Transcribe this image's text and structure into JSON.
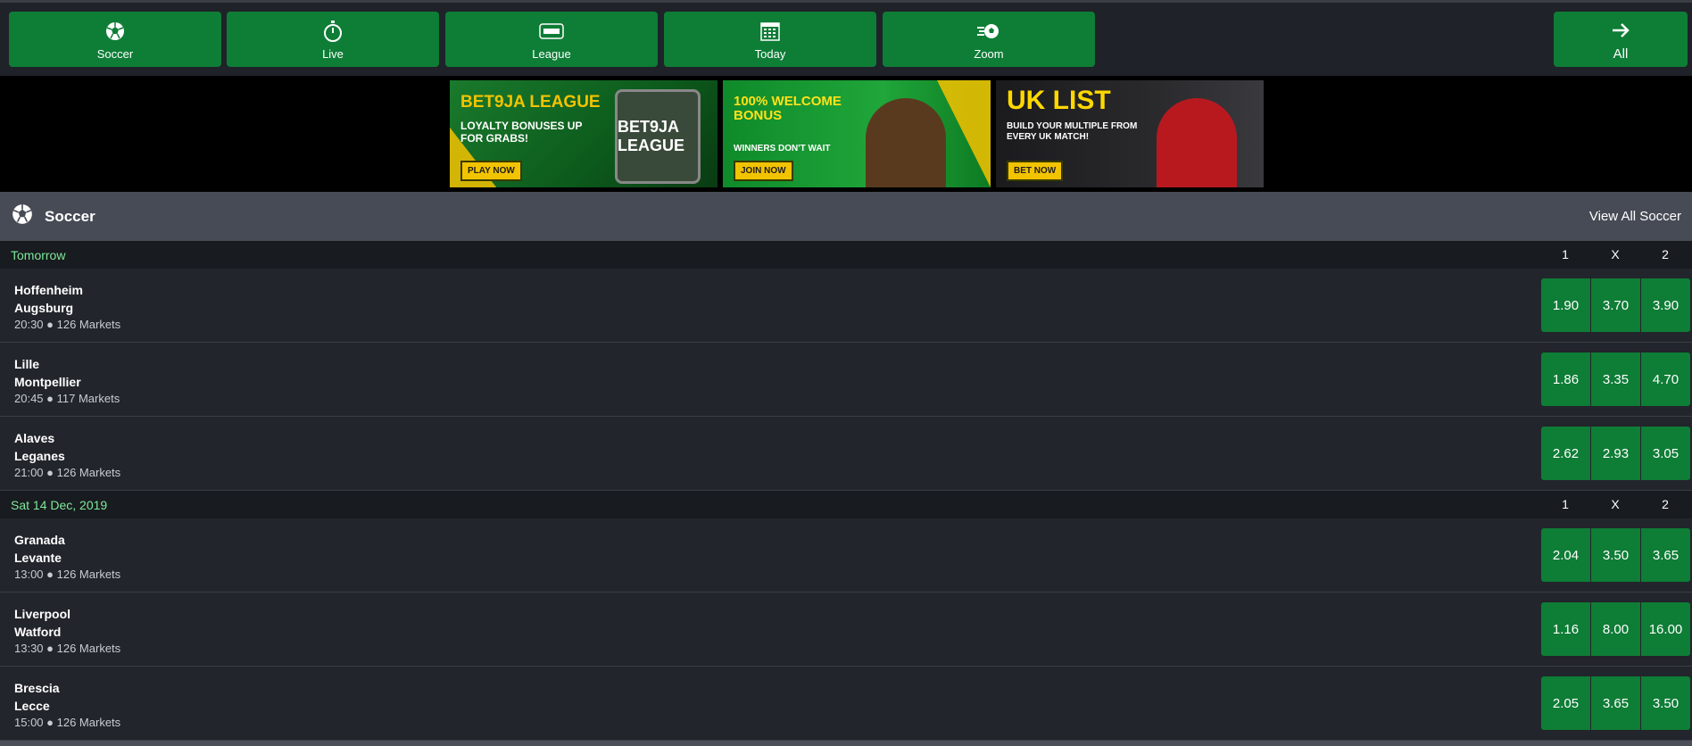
{
  "nav": {
    "buttons": [
      {
        "label": "Soccer",
        "icon": "soccer-ball-icon"
      },
      {
        "label": "Live",
        "icon": "stopwatch-icon"
      },
      {
        "label": "League",
        "icon": "bet9ja-league-icon"
      },
      {
        "label": "Today",
        "icon": "calendar-icon"
      },
      {
        "label": "Zoom",
        "icon": "zoom-ball-icon"
      }
    ],
    "all_label": "All"
  },
  "banners": [
    {
      "headline": "BET9JA LEAGUE",
      "sub": "LOYALTY BONUSES UP FOR GRABS!",
      "cta": "PLAY NOW",
      "art": "BET9JA LEAGUE"
    },
    {
      "headline": "100% WELCOME BONUS",
      "sub": "WINNERS DON'T WAIT",
      "cta": "JOIN NOW"
    },
    {
      "headline": "UK LIST",
      "sub": "BUILD YOUR MULTIPLE FROM EVERY UK MATCH!",
      "cta": "BET NOW"
    }
  ],
  "section": {
    "title": "Soccer",
    "view_all": "View All Soccer"
  },
  "columns": [
    "1",
    "X",
    "2"
  ],
  "groups": [
    {
      "date": "Tomorrow",
      "matches": [
        {
          "home": "Hoffenheim",
          "away": "Augsburg",
          "time": "20:30",
          "markets": "126 Markets",
          "odds": [
            "1.90",
            "3.70",
            "3.90"
          ]
        },
        {
          "home": "Lille",
          "away": "Montpellier",
          "time": "20:45",
          "markets": "117 Markets",
          "odds": [
            "1.86",
            "3.35",
            "4.70"
          ]
        },
        {
          "home": "Alaves",
          "away": "Leganes",
          "time": "21:00",
          "markets": "126 Markets",
          "odds": [
            "2.62",
            "2.93",
            "3.05"
          ]
        }
      ]
    },
    {
      "date": "Sat 14 Dec, 2019",
      "matches": [
        {
          "home": "Granada",
          "away": "Levante",
          "time": "13:00",
          "markets": "126 Markets",
          "odds": [
            "2.04",
            "3.50",
            "3.65"
          ]
        },
        {
          "home": "Liverpool",
          "away": "Watford",
          "time": "13:30",
          "markets": "126 Markets",
          "odds": [
            "1.16",
            "8.00",
            "16.00"
          ]
        },
        {
          "home": "Brescia",
          "away": "Lecce",
          "time": "15:00",
          "markets": "126 Markets",
          "odds": [
            "2.05",
            "3.65",
            "3.50"
          ]
        }
      ]
    }
  ],
  "colors": {
    "green": "#0e7d36",
    "date_green": "#7fe89a",
    "header": "#474b55"
  }
}
